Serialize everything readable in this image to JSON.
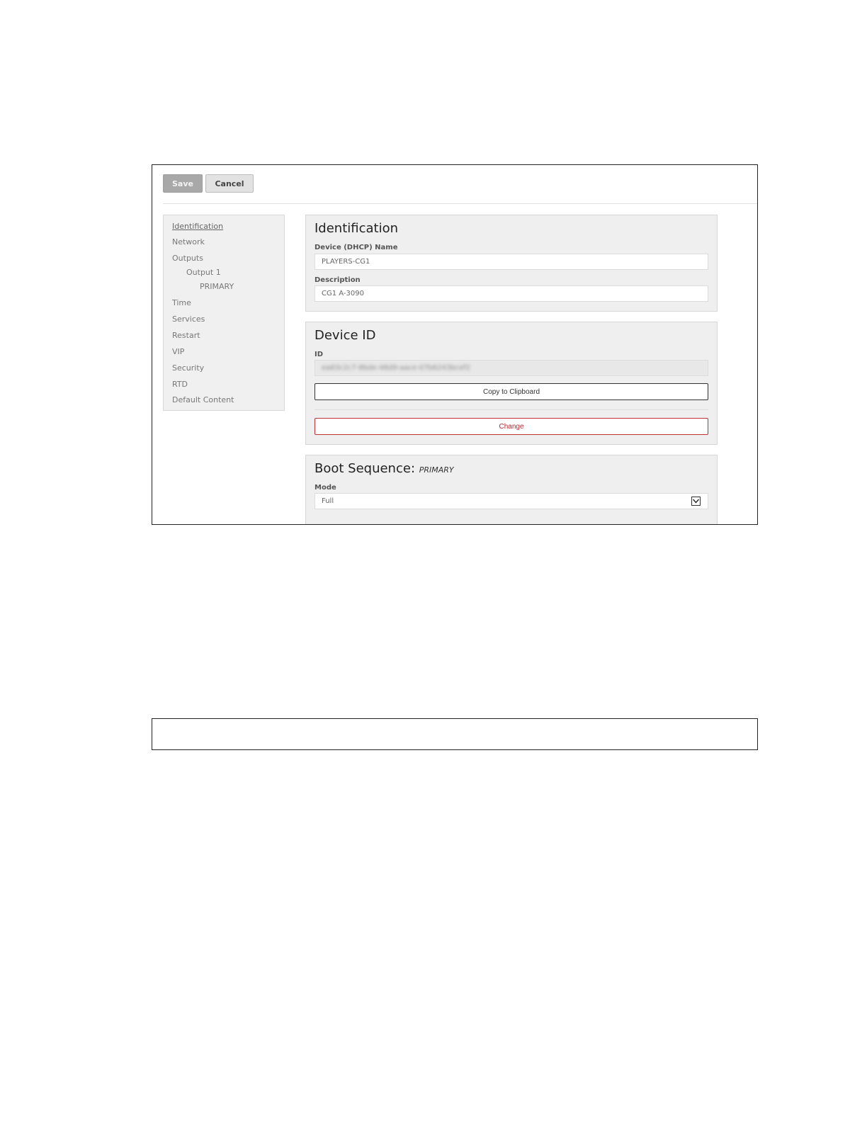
{
  "toolbar": {
    "save_label": "Save",
    "cancel_label": "Cancel"
  },
  "sidebar": {
    "items": [
      {
        "label": "Identification",
        "active": true
      },
      {
        "label": "Network"
      },
      {
        "label": "Outputs"
      },
      {
        "label": "Output 1"
      },
      {
        "label": "PRIMARY"
      },
      {
        "label": "Time"
      },
      {
        "label": "Services"
      },
      {
        "label": "Restart"
      },
      {
        "label": "VIP"
      },
      {
        "label": "Security"
      },
      {
        "label": "RTD"
      },
      {
        "label": "Default Content"
      }
    ]
  },
  "identification": {
    "title": "Identification",
    "device_name_label": "Device (DHCP) Name",
    "device_name_value": "PLAYERS-CG1",
    "description_label": "Description",
    "description_value": "CG1 A-3090"
  },
  "device_id": {
    "title": "Device ID",
    "id_label": "ID",
    "id_value": "ea83c2c7-8bde-48d9-aace-07b6243bcef2",
    "copy_label": "Copy to Clipboard",
    "change_label": "Change"
  },
  "boot_sequence": {
    "title": "Boot Sequence:",
    "subtitle": "PRIMARY",
    "mode_label": "Mode",
    "mode_value": "Full"
  },
  "colors": {
    "accent_danger": "#b5262e",
    "save_bg": "#a8a8a8",
    "panel_bg": "#efefef"
  }
}
